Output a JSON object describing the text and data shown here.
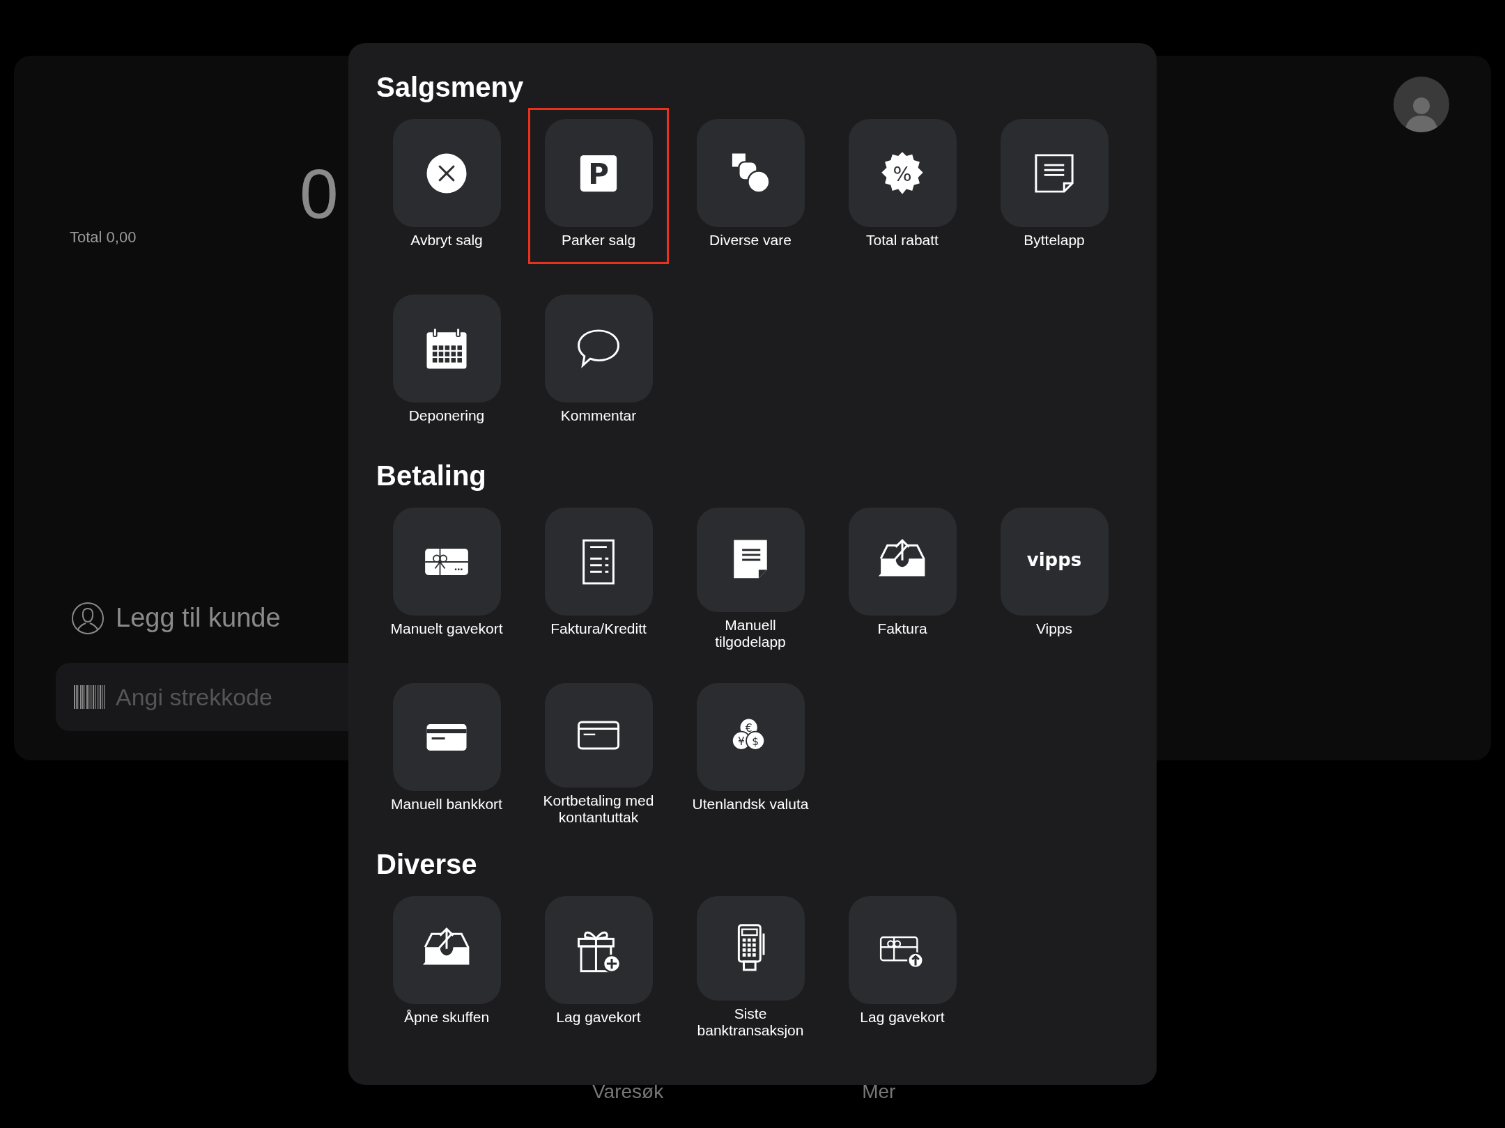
{
  "register": {
    "amount": "0",
    "total": "Total 0,00",
    "customer_link": "Legg til kunde",
    "barcode_field": {
      "placeholder": "Angi strekkode"
    }
  },
  "bottom_nav": [
    "Varesøk",
    "Mer"
  ],
  "menu": {
    "sections": [
      {
        "title": "Salgsmeny",
        "items": [
          {
            "label": "Avbryt salg",
            "highlighted": false
          },
          {
            "label": "Parker salg",
            "highlighted": true,
            "icon_text": "P"
          },
          {
            "label": "Diverse vare",
            "highlighted": false
          },
          {
            "label": "Total rabatt",
            "highlighted": false,
            "icon_text": "%"
          },
          {
            "label": "Byttelapp",
            "highlighted": false
          },
          {
            "label": "Deponering",
            "highlighted": false
          },
          {
            "label": "Kommentar",
            "highlighted": false
          }
        ]
      },
      {
        "title": "Betaling",
        "items": [
          {
            "label": "Manuelt gavekort",
            "highlighted": false
          },
          {
            "label": "Faktura/Kreditt",
            "highlighted": false
          },
          {
            "label": "Manuell tilgodelapp",
            "highlighted": false
          },
          {
            "label": "Faktura",
            "highlighted": false
          },
          {
            "label": "Vipps",
            "highlighted": false,
            "icon_text": "vipps"
          },
          {
            "label": "Manuell bankkort",
            "highlighted": false
          },
          {
            "label": "Kortbetaling med kontantuttak",
            "highlighted": false
          },
          {
            "label": "Utenlandsk valuta",
            "highlighted": false,
            "icon_texts": [
              "€",
              "¥",
              "$"
            ]
          }
        ]
      },
      {
        "title": "Diverse",
        "items": [
          {
            "label": "Åpne skuffen",
            "highlighted": false
          },
          {
            "label": "Lag gavekort",
            "highlighted": false
          },
          {
            "label": "Siste banktransaksjon",
            "highlighted": false
          },
          {
            "label": "Lag gavekort",
            "highlighted": false
          }
        ]
      }
    ]
  }
}
